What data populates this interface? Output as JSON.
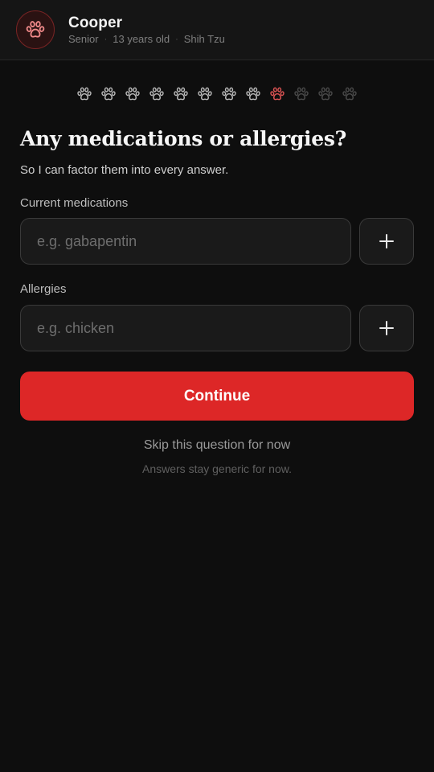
{
  "pet": {
    "name": "Cooper",
    "life_stage": "Senior",
    "age": "13 years old",
    "breed": "Shih Tzu",
    "avatar_icon": "paw-icon",
    "meta_separator": "·"
  },
  "progress": {
    "total_steps": 12,
    "current_step": 9,
    "step_icon": "paw-icon",
    "colors": {
      "completed": "#bdbdbd",
      "current": "#e05555",
      "upcoming": "#4a4a4a"
    }
  },
  "question": {
    "title": "Any medications or allergies?",
    "subtitle": "So I can factor them into every answer."
  },
  "medications": {
    "label": "Current medications",
    "value": "",
    "placeholder": "e.g. gabapentin",
    "add_icon": "plus-icon"
  },
  "allergies": {
    "label": "Allergies",
    "value": "",
    "placeholder": "e.g. chicken",
    "add_icon": "plus-icon"
  },
  "actions": {
    "continue_label": "Continue",
    "skip_label": "Skip this question for now",
    "footnote": "Answers stay generic for now."
  },
  "theme": {
    "accent": "#dd2727",
    "background": "#0e0e0e",
    "header_background": "#151515"
  }
}
